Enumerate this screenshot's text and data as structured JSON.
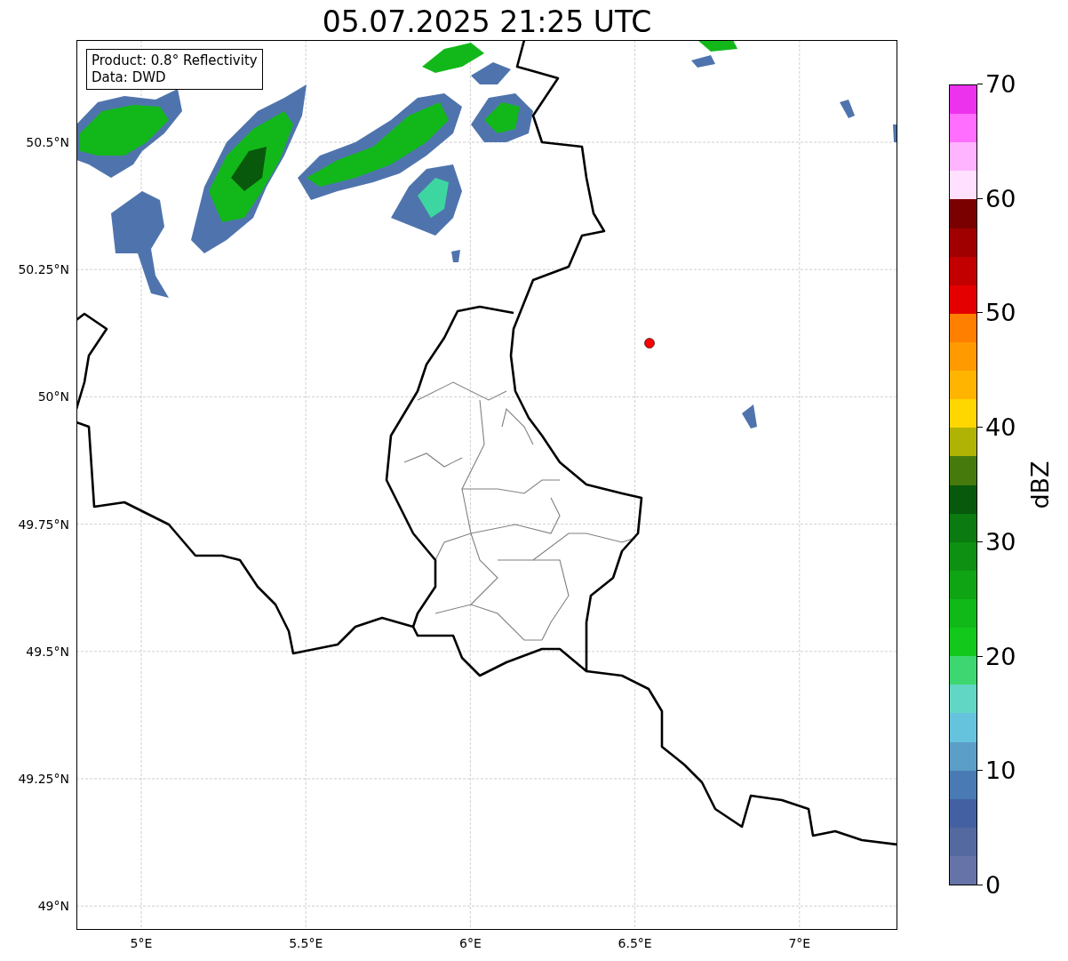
{
  "title": "05.07.2025 21:25 UTC",
  "info_box": [
    "Product: 0.8° Reflectivity",
    "Data: DWD"
  ],
  "map": {
    "y_ticks": [
      "50.5°N",
      "50.25°N",
      "50°N",
      "49.75°N",
      "49.5°N",
      "49.25°N",
      "49°N"
    ],
    "x_ticks": [
      "5°E",
      "5.5°E",
      "6°E",
      "6.5°E",
      "7°E"
    ],
    "marker": {
      "color": "#ff0000"
    }
  },
  "colorbar": {
    "label": "dBZ",
    "ticks": [
      "70",
      "60",
      "50",
      "40",
      "30",
      "20",
      "10",
      "0"
    ],
    "segments": [
      {
        "color": "#ec32ec"
      },
      {
        "color": "#ff6eff"
      },
      {
        "color": "#ffb4ff"
      },
      {
        "color": "#ffe0ff"
      },
      {
        "color": "#7a0000"
      },
      {
        "color": "#a00000"
      },
      {
        "color": "#c20000"
      },
      {
        "color": "#e40000"
      },
      {
        "color": "#ff7f00"
      },
      {
        "color": "#ff9a00"
      },
      {
        "color": "#ffb400"
      },
      {
        "color": "#ffd700"
      },
      {
        "color": "#b0b204"
      },
      {
        "color": "#467a0c"
      },
      {
        "color": "#08590b"
      },
      {
        "color": "#0b7a10"
      },
      {
        "color": "#0e9012"
      },
      {
        "color": "#0fa414"
      },
      {
        "color": "#10b818"
      },
      {
        "color": "#12c81a"
      },
      {
        "color": "#3ed670"
      },
      {
        "color": "#62d6c4"
      },
      {
        "color": "#66c3dd"
      },
      {
        "color": "#5b9ec8"
      },
      {
        "color": "#4a7ab3"
      },
      {
        "color": "#4360a3"
      },
      {
        "color": "#53699f"
      },
      {
        "color": "#6673a8"
      }
    ]
  }
}
